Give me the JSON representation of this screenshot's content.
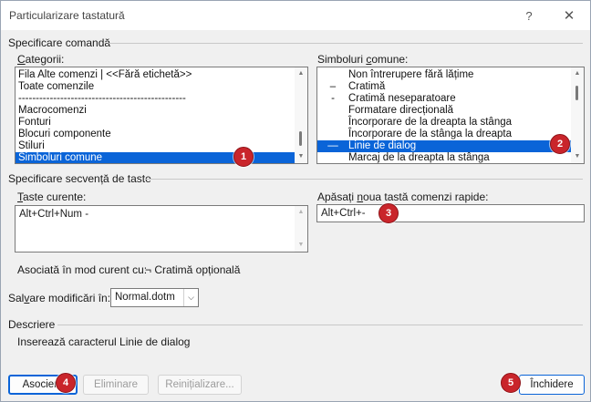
{
  "window": {
    "title": "Particularizare tastatură",
    "help_glyph": "?",
    "close_glyph": "✕"
  },
  "command_section": {
    "title": "Specificare comandă"
  },
  "categories": {
    "label_pre": "",
    "label_ul": "C",
    "label_post": "ategorii:",
    "items": [
      "Fila Alte comenzi | <<Fără etichetă>>",
      "Toate comenzile",
      "------------------------------------------------",
      "Macrocomenzi",
      "Fonturi",
      "Blocuri componente",
      "Stiluri",
      "Simboluri comune"
    ],
    "selected_index": 7
  },
  "symbols": {
    "label_pre": "Simboluri ",
    "label_ul": "c",
    "label_post": "omune:",
    "items": [
      {
        "glyph": "",
        "name": "Non întrerupere fără lățime"
      },
      {
        "glyph": "–",
        "name": "Cratimă"
      },
      {
        "glyph": "-",
        "name": "Cratimă neseparatoare"
      },
      {
        "glyph": "",
        "name": "Formatare direcțională"
      },
      {
        "glyph": "",
        "name": "Încorporare de la dreapta la stânga"
      },
      {
        "glyph": "",
        "name": "Încorporare de la stânga la dreapta"
      },
      {
        "glyph": "—",
        "name": "Linie de dialog"
      },
      {
        "glyph": "",
        "name": "Marcaj de la dreapta la stânga"
      }
    ],
    "selected_index": 6
  },
  "keys_section": {
    "title": "Specificare secvență de taste"
  },
  "current_keys": {
    "label_pre": "",
    "label_ul": "T",
    "label_post": "aste curente:",
    "value": "Alt+Ctrl+Num -"
  },
  "new_key": {
    "label_pre": "Apăsați ",
    "label_ul": "n",
    "label_post": "oua tastă comenzi rapide:",
    "value": "Alt+Ctrl+-"
  },
  "assigned": {
    "label": "Asociată în mod curent cu:",
    "value": "¬  Cratimă opțională"
  },
  "save": {
    "label_pre": "Sal",
    "label_ul": "v",
    "label_post": "are modificări în:",
    "value": "Normal.dotm"
  },
  "description": {
    "title": "Descriere",
    "text": "Inserează caracterul Linie de dialog"
  },
  "buttons": {
    "assign": "Asociere",
    "remove": "Eliminare",
    "reset": "Reinițializare...",
    "close": "Închidere"
  },
  "badges": [
    "1",
    "2",
    "3",
    "4",
    "5"
  ],
  "colors": {
    "selection": "#0a64d8",
    "badge": "#c9252b"
  }
}
